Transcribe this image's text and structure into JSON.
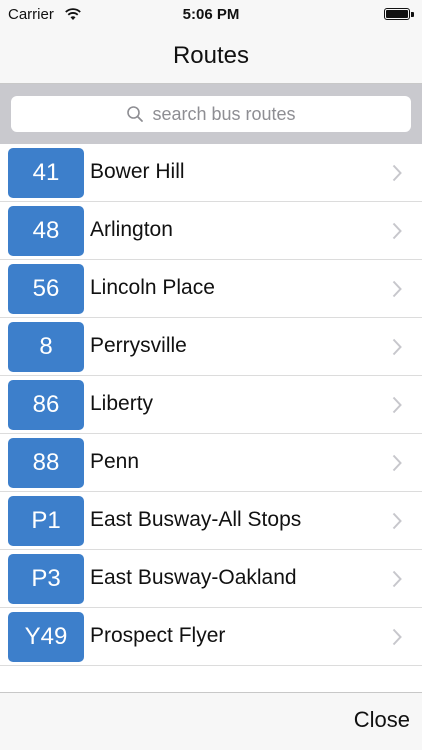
{
  "status_bar": {
    "carrier": "Carrier",
    "time": "5:06 PM"
  },
  "nav": {
    "title": "Routes"
  },
  "search": {
    "placeholder": "search bus routes"
  },
  "routes": [
    {
      "number": "41",
      "name": "Bower Hill"
    },
    {
      "number": "48",
      "name": "Arlington"
    },
    {
      "number": "56",
      "name": "Lincoln Place"
    },
    {
      "number": "8",
      "name": "Perrysville"
    },
    {
      "number": "86",
      "name": "Liberty"
    },
    {
      "number": "88",
      "name": "Penn"
    },
    {
      "number": "P1",
      "name": "East Busway-All Stops"
    },
    {
      "number": "P3",
      "name": "East Busway-Oakland"
    },
    {
      "number": "Y49",
      "name": "Prospect Flyer"
    }
  ],
  "toolbar": {
    "close_label": "Close"
  },
  "colors": {
    "badge": "#3d7fcb",
    "search_bar_bg": "#c9c9ce",
    "bar_bg": "#f7f7f7"
  },
  "icons": {
    "wifi": "wifi-icon",
    "battery": "battery-icon",
    "search": "search-icon",
    "chevron": "chevron-right-icon"
  }
}
